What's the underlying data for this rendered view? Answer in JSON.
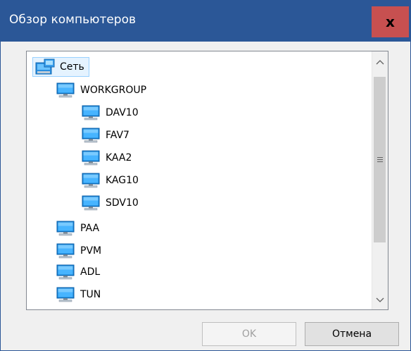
{
  "window": {
    "title": "Обзор компьютеров",
    "close_label": "x",
    "title_bar_color": "#2b5797",
    "close_button_color": "#c75050"
  },
  "tree": {
    "root": {
      "label": "Сеть",
      "icon": "network-icon",
      "selected": true
    },
    "workgroup": {
      "label": "WORKGROUP",
      "icon": "computer-icon",
      "children": [
        {
          "label": "DAV10",
          "icon": "computer-icon"
        },
        {
          "label": "FAV7",
          "icon": "computer-icon"
        },
        {
          "label": "KAA2",
          "icon": "computer-icon"
        },
        {
          "label": "KAG10",
          "icon": "computer-icon"
        },
        {
          "label": "SDV10",
          "icon": "computer-icon"
        }
      ]
    },
    "computers": [
      {
        "label": "PAA",
        "icon": "computer-icon"
      },
      {
        "label": "PVM",
        "icon": "computer-icon"
      },
      {
        "label": "ADL",
        "icon": "computer-icon"
      },
      {
        "label": "TUN",
        "icon": "computer-icon"
      }
    ]
  },
  "scrollbar": {
    "up_arrow": "^",
    "down_arrow": "v"
  },
  "buttons": {
    "ok_label": "OK",
    "ok_enabled": false,
    "cancel_label": "Отмена"
  }
}
